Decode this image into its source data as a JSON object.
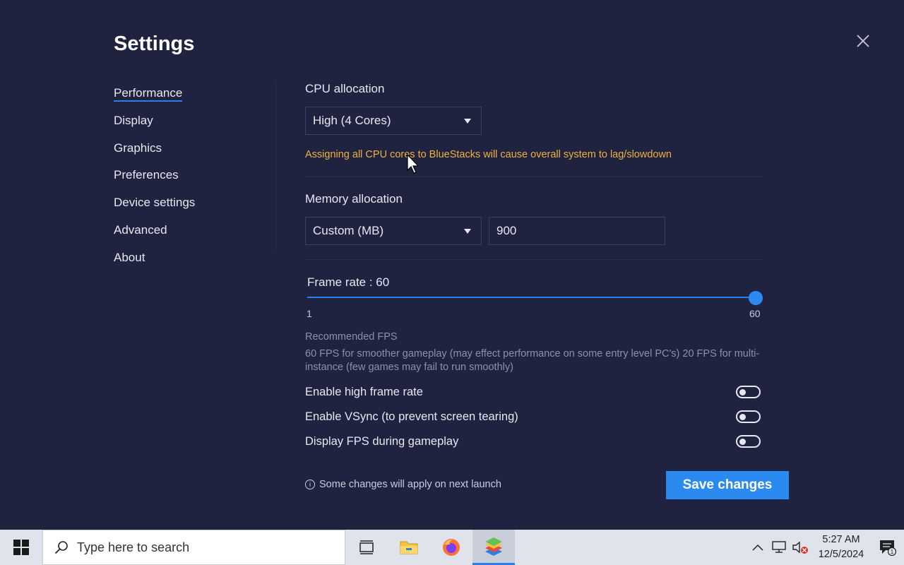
{
  "window": {
    "title": "Settings"
  },
  "nav": {
    "items": [
      {
        "label": "Performance",
        "active": true
      },
      {
        "label": "Display"
      },
      {
        "label": "Graphics"
      },
      {
        "label": "Preferences"
      },
      {
        "label": "Device settings"
      },
      {
        "label": "Advanced"
      },
      {
        "label": "About"
      }
    ]
  },
  "cpu": {
    "label": "CPU allocation",
    "selected": "High (4 Cores)",
    "warning": "Assigning all CPU cores to BlueStacks will cause overall system to lag/slowdown"
  },
  "memory": {
    "label": "Memory allocation",
    "selected": "Custom (MB)",
    "value": "900"
  },
  "frame_rate": {
    "label": "Frame rate : 60",
    "min_label": "1",
    "max_label": "60",
    "value": 60,
    "min": 1,
    "max": 60,
    "recommended_title": "Recommended FPS",
    "recommended_text": "60 FPS for smoother gameplay (may effect performance on some entry level PC's) 20 FPS for multi-instance (few games may fail to run smoothly)"
  },
  "toggles": [
    {
      "label": "Enable high frame rate",
      "on": false
    },
    {
      "label": "Enable VSync (to prevent screen tearing)",
      "on": false
    },
    {
      "label": "Display FPS during gameplay",
      "on": false
    }
  ],
  "footer": {
    "note": "Some changes will apply on next launch",
    "save_label": "Save changes"
  },
  "taskbar": {
    "search_placeholder": "Type here to search",
    "time": "5:27 AM",
    "date": "12/5/2024",
    "notification_count": "1"
  },
  "colors": {
    "background": "#1f2340",
    "accent": "#2b8af0",
    "warning": "#f0b03c"
  }
}
